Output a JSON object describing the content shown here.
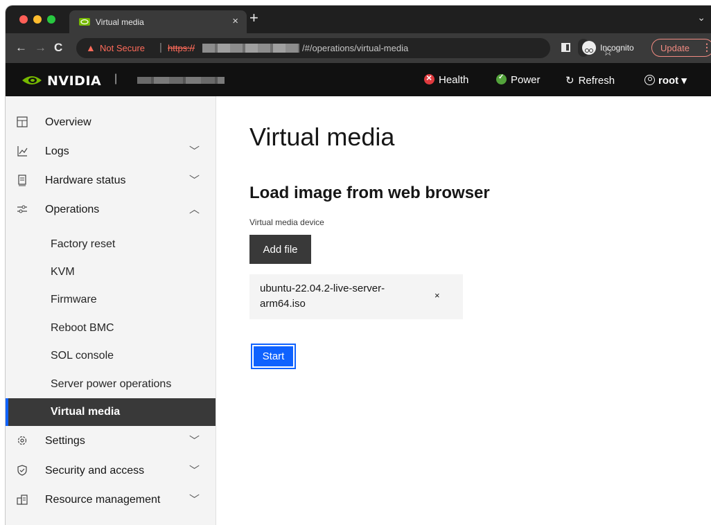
{
  "browser": {
    "tab_title": "Virtual media",
    "tab_close": "×",
    "new_tab": "+",
    "tab_menu": "⌄",
    "security_label": "Not Secure",
    "url_scheme": "https://",
    "url_path": "/#/operations/virtual-media",
    "incognito_label": "Incognito",
    "update_label": "Update"
  },
  "header": {
    "brand": "NVIDIA",
    "separator": "|",
    "health_label": "Health",
    "power_label": "Power",
    "refresh_label": "Refresh",
    "user_label": "root",
    "user_caret": "▾",
    "health_color": "#e03a3e",
    "power_color": "#53a33b"
  },
  "sidebar": {
    "items": [
      {
        "label": "Overview",
        "icon": "overview-icon"
      },
      {
        "label": "Logs",
        "icon": "logs-icon",
        "chevron": "﹀"
      },
      {
        "label": "Hardware status",
        "icon": "hardware-icon",
        "chevron": "﹀"
      },
      {
        "label": "Operations",
        "icon": "operations-icon",
        "chevron": "︿"
      }
    ],
    "operations_sub": [
      {
        "label": "Factory reset"
      },
      {
        "label": "KVM"
      },
      {
        "label": "Firmware"
      },
      {
        "label": "Reboot BMC"
      },
      {
        "label": "SOL console"
      },
      {
        "label": "Server power operations"
      },
      {
        "label": "Virtual media",
        "active": true
      }
    ],
    "bottom_items": [
      {
        "label": "Settings",
        "icon": "settings-icon",
        "chevron": "﹀"
      },
      {
        "label": "Security and access",
        "icon": "security-icon",
        "chevron": "﹀"
      },
      {
        "label": "Resource management",
        "icon": "resource-icon",
        "chevron": "﹀"
      }
    ]
  },
  "main": {
    "page_title": "Virtual media",
    "section_title": "Load image from web browser",
    "device_label": "Virtual media device",
    "add_file_label": "Add file",
    "file_name": "ubuntu-22.04.2-live-server-arm64.iso",
    "file_remove": "×",
    "start_label": "Start",
    "accent_color": "#0f62fe"
  }
}
